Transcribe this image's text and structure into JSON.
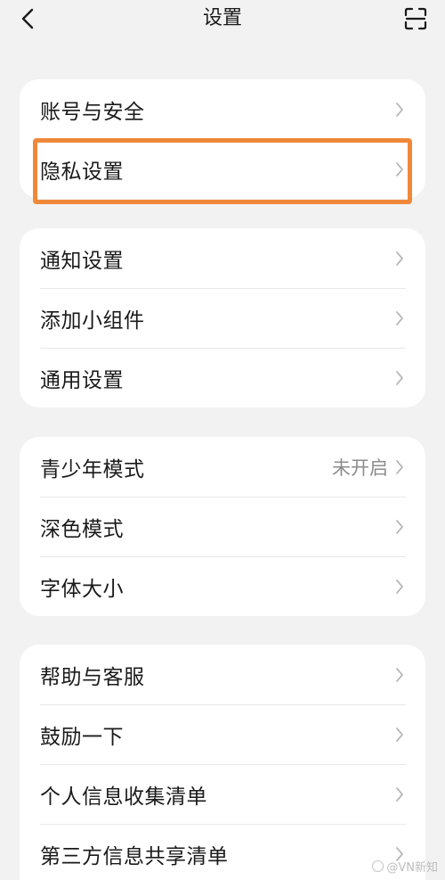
{
  "header": {
    "title": "设置",
    "back_icon": "chevron-left-icon",
    "scan_icon": "scan-icon"
  },
  "groups": [
    {
      "items": [
        {
          "label": "账号与安全"
        },
        {
          "label": "隐私设置"
        }
      ]
    },
    {
      "items": [
        {
          "label": "通知设置"
        },
        {
          "label": "添加小组件"
        },
        {
          "label": "通用设置"
        }
      ]
    },
    {
      "items": [
        {
          "label": "青少年模式",
          "value": "未开启"
        },
        {
          "label": "深色模式"
        },
        {
          "label": "字体大小"
        }
      ]
    },
    {
      "items": [
        {
          "label": "帮助与客服"
        },
        {
          "label": "鼓励一下"
        },
        {
          "label": "个人信息收集清单"
        },
        {
          "label": "第三方信息共享清单"
        }
      ]
    }
  ],
  "highlight": {
    "color": "#f0883a",
    "target": "隐私设置"
  },
  "watermark": "@VN新知",
  "colors": {
    "background": "#f2f2f2",
    "card": "#ffffff",
    "text": "#1a1a1a",
    "secondary_text": "#8c8c8c",
    "chevron": "#b8b8b8"
  }
}
